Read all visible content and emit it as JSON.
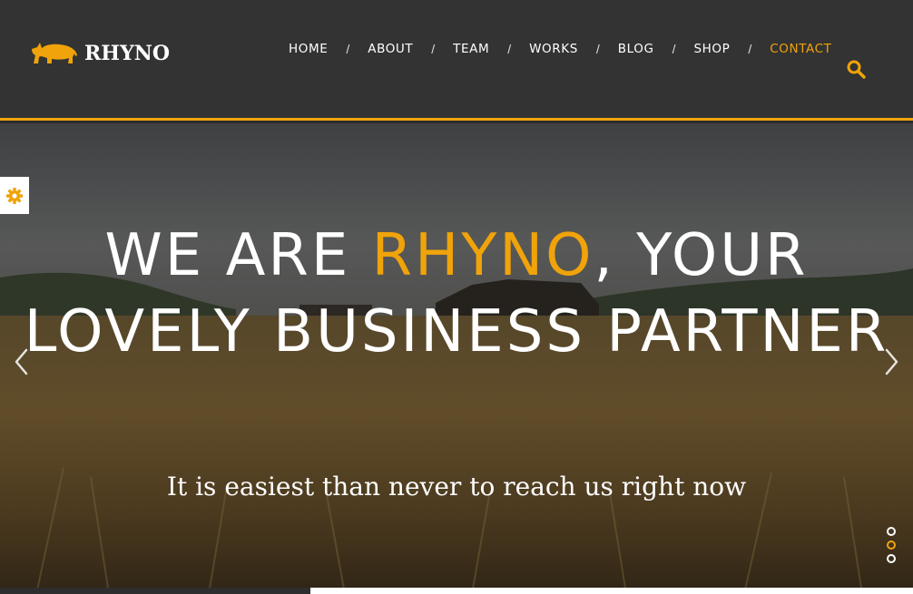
{
  "brand": {
    "name": "RHYNO"
  },
  "nav": {
    "items": [
      {
        "label": "HOME"
      },
      {
        "label": "ABOUT"
      },
      {
        "label": "TEAM"
      },
      {
        "label": "WORKS"
      },
      {
        "label": "BLOG"
      },
      {
        "label": "SHOP"
      },
      {
        "label": "CONTACT",
        "active": true
      }
    ],
    "separator": "/"
  },
  "hero": {
    "headline_part1": "WE ARE ",
    "headline_accent": "RHYNO",
    "headline_part2": ", YOUR LOVELY BUSINESS PARTNER",
    "subtitle": "It is easiest than never to reach us right now",
    "slides": 3,
    "active_slide": 2,
    "progress": 0.34
  },
  "icons": {
    "search": "search-icon",
    "settings": "gear-icon",
    "prev": "chevron-left-icon",
    "next": "chevron-right-icon",
    "logo": "rhino-icon"
  },
  "colors": {
    "accent": "#f0a30a",
    "header_bg": "#333333",
    "text": "#ffffff"
  }
}
